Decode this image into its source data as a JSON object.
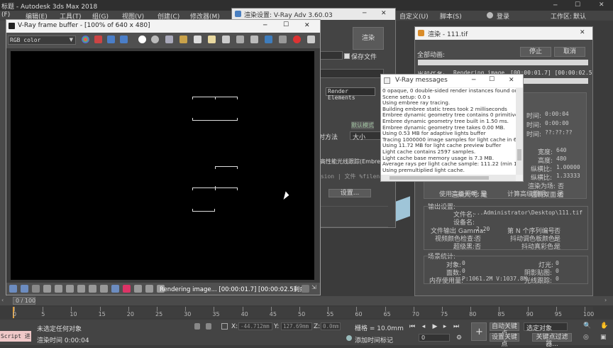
{
  "app": {
    "title": "标题 - Autodesk 3ds Max 2018",
    "menu": [
      "(F)",
      "编辑(E)",
      "工具(T)",
      "组(G)",
      "视图(V)",
      "创建(C)",
      "修改器(M)"
    ],
    "menu_right": [
      "自定义(U)",
      "脚本(S)"
    ],
    "login": "登录",
    "workspace_label": "工作区:",
    "workspace_value": "默认"
  },
  "render_setup": {
    "title": "渲染设置: V-Ray Adv 3.60.03",
    "render_button": "渲染",
    "save_file_label": "保存文件",
    "tab_render_elements": "Render Elements",
    "method_label": "时方法",
    "size_value": "大小",
    "default_mode": "默认模式",
    "embree_label": "高性能光线跟踪(Embree)",
    "version_row": "rsion  |  文件  %filena",
    "settings_button": "设置..."
  },
  "frame_buffer": {
    "title": "V-Ray frame buffer - [100% of 640 x 480]",
    "channel": "RGB color",
    "status": "Rendering image... [00:00:01.7] [00:00:02.5剩余]"
  },
  "render_progress": {
    "title": "渲染 - 111.tif",
    "all_anim_label": "全部动画:",
    "stop_button": "停止",
    "cancel_button": "取消",
    "current_task_label": "当前任务:",
    "current_task_value": "Rendering image",
    "current_task_time": "[00:00:01.7] [00:00:02.5剩",
    "time_rows": [
      {
        "label": "时间:",
        "value": "0:00:04"
      },
      {
        "label": "时间:",
        "value": "0:00:00"
      },
      {
        "label": "时间:",
        "value": "??:??:??"
      }
    ],
    "dims": [
      {
        "label": "宽度:",
        "value": "640"
      },
      {
        "label": "高度:",
        "value": "480"
      },
      {
        "label": "纵横比:",
        "value": "1.00000"
      },
      {
        "label": "纵横比:",
        "value": "1.33333"
      }
    ],
    "render_fields_label": "渲染为场:",
    "render_fields_value": "否",
    "atmos_label": "渲染大气:",
    "atmos_value": "是",
    "force_2side_label": "强制双面:",
    "force_2side_value": "否",
    "adv_light_label": "使用高级照明:",
    "adv_light_value": "是",
    "calc_adv_light_label": "计算高级照明:",
    "calc_adv_light_value": "是",
    "output_header": "输出设置:",
    "file_name_label": "文件名:",
    "file_name_value": "...Administrator\\Desktop\\111.tif",
    "device_label": "设备名:",
    "file_output_gamma_label": "文件输出 Gamma:",
    "file_output_gamma_value": "2.20",
    "nth_serial_label": "第 N 个序列编号:",
    "nth_serial_value": "否",
    "video_check_label": "视频颜色检查:",
    "video_check_value": "否",
    "dither_paletted_label": "抖动调色板颜色:",
    "dither_paletted_value": "是",
    "super_black_label": "超级黑:",
    "super_black_value": "否",
    "dither_true_label": "抖动真彩色:",
    "dither_true_value": "是",
    "scene_header": "场景统计:",
    "objects_label": "对象:",
    "objects_value": "0",
    "lights_label": "灯光:",
    "lights_value": "0",
    "faces_label": "面数:",
    "faces_value": "0",
    "shadow_label": "阴影贴图:",
    "shadow_value": "0",
    "memory_label": "内存使用量:",
    "memory_value": "P:1061.2M V:1037.8M",
    "raytrace_label": "光线跟踪:",
    "raytrace_value": "0"
  },
  "vray_messages": {
    "title": "V-Ray messages",
    "lines": [
      "0 opaque, 0 double-sided render instances found out of 1 tot",
      "Scene setup: 0.0 s",
      "Using embree ray tracing.",
      "Building embree static trees took 2 milliseconds",
      "Embree dynamic geometry tree contains 0 primitives.",
      "Embree dynamic geometry tree built in 1.50 ms.",
      "Embree dynamic geometry tree takes 0.00 MB.",
      "Using 0.53 MB for adaptive lights buffer",
      "Tracing 1000000 image samples for light cache in 64 passes",
      "Using 11.72 MB for light cache preview buffer",
      "Light cache contains 2597 samples.",
      "Light cache base memory usage is 7.3 MB.",
      "Average rays per light cache sample: 111.22 (min 1, max 39",
      "Using premultiplied light cache."
    ]
  },
  "timeline": {
    "frame_label": "0 / 100",
    "ticks": [
      "0",
      "5",
      "10",
      "15",
      "20",
      "25",
      "30",
      "35",
      "40",
      "45",
      "50",
      "55",
      "60",
      "65",
      "70",
      "75",
      "80",
      "85",
      "90",
      "95",
      "100"
    ]
  },
  "status_bar": {
    "script_label": "Script 进",
    "selection_status": "未选定任何对象",
    "render_time": "渲染时间  0:00:04",
    "x_value": "-44.712mm",
    "y_value": "127.69mm",
    "z_value": "0.0mm",
    "grid_label": "栅格 = 10.0mm",
    "add_time_tag": "添加时间标记",
    "auto_key": "自动关键点",
    "set_key": "设置关键点",
    "selected_object": "选定对象",
    "key_filter": "关键点过滤器...",
    "frame_value": "0"
  }
}
